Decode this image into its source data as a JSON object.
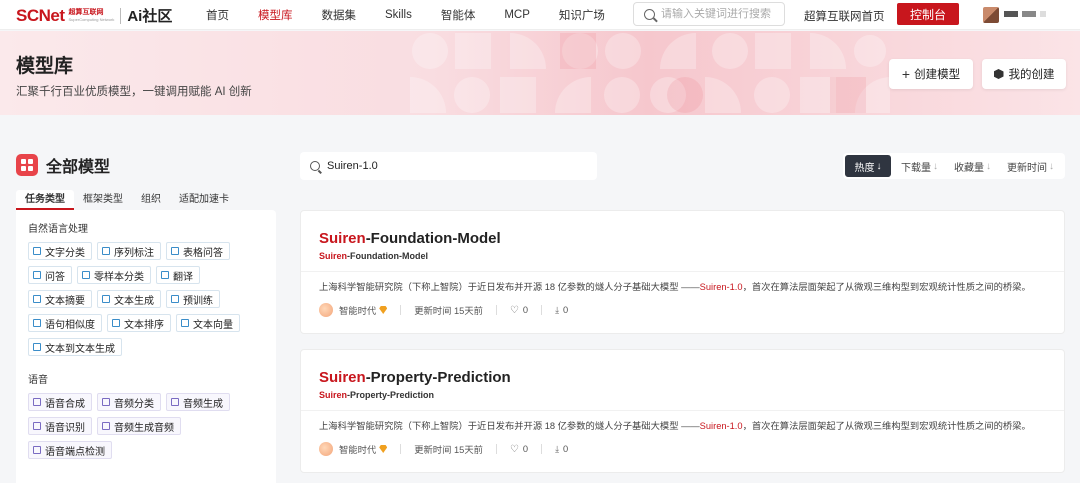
{
  "nav": {
    "logo_main": "SCNet",
    "logo_sub_cn": "超算互联网",
    "logo_sub_en": "SuperComputing Network",
    "logo_ai": "Ai社区",
    "items": [
      {
        "label": "首页"
      },
      {
        "label": "模型库"
      },
      {
        "label": "数据集"
      },
      {
        "label": "Skills"
      },
      {
        "label": "智能体"
      },
      {
        "label": "MCP"
      },
      {
        "label": "知识广场"
      }
    ],
    "active_item": "模型库",
    "search_placeholder": "请输入关键词进行搜索",
    "home_link": "超算互联网首页",
    "console_label": "控制台",
    "accent_color": "#c8161d"
  },
  "banner": {
    "title": "模型库",
    "subtitle": "汇聚千行百业优质模型，一键调用赋能 AI 创新",
    "create_label": "创建模型",
    "mine_label": "我的创建"
  },
  "sidebar": {
    "title": "全部模型",
    "tabs": [
      "任务类型",
      "框架类型",
      "组织",
      "适配加速卡"
    ],
    "active_tab": "任务类型",
    "sections": [
      {
        "title": "自然语言处理",
        "tags": [
          "文字分类",
          "序列标注",
          "表格问答",
          "问答",
          "零样本分类",
          "翻译",
          "文本摘要",
          "文本生成",
          "预训练",
          "语句相似度",
          "文本排序",
          "文本向量",
          "文本到文本生成"
        ]
      },
      {
        "title": "语音",
        "tags": [
          "语音合成",
          "音频分类",
          "音频生成",
          "语音识别",
          "音频生成音频",
          "语音端点检测"
        ]
      }
    ]
  },
  "main": {
    "search_value": "Suiren-1.0",
    "sort_options": [
      {
        "label": "热度",
        "arrow": "↓"
      },
      {
        "label": "下载量",
        "arrow": "↓"
      },
      {
        "label": "收藏量",
        "arrow": "↓"
      },
      {
        "label": "更新时间",
        "arrow": "↓"
      }
    ],
    "active_sort": "热度",
    "cards": [
      {
        "title_hl": "Suiren",
        "title_rest": "-Foundation-Model",
        "sub_hl": "Suiren",
        "sub_rest": "-Foundation-Model",
        "desc_pre": "上海科学智能研究院（下称上智院）于近日发布并开源 18 亿参数的燧人分子基础大模型 ——",
        "desc_hl": "Suiren-1.0",
        "desc_post": "，首次在算法层面架起了从微观三维构型到宏观统计性质之间的桥梁。",
        "org": "智能时代",
        "updated": "更新时间 15天前",
        "likes": "0",
        "downloads": "0"
      },
      {
        "title_hl": "Suiren",
        "title_rest": "-Property-Prediction",
        "sub_hl": "Suiren",
        "sub_rest": "-Property-Prediction",
        "desc_pre": "上海科学智能研究院（下称上智院）于近日发布并开源 18 亿参数的燧人分子基础大模型 ——",
        "desc_hl": "Suiren-1.0",
        "desc_post": "，首次在算法层面架起了从微观三维构型到宏观统计性质之间的桥梁。",
        "org": "智能时代",
        "updated": "更新时间 15天前",
        "likes": "0",
        "downloads": "0"
      }
    ]
  }
}
